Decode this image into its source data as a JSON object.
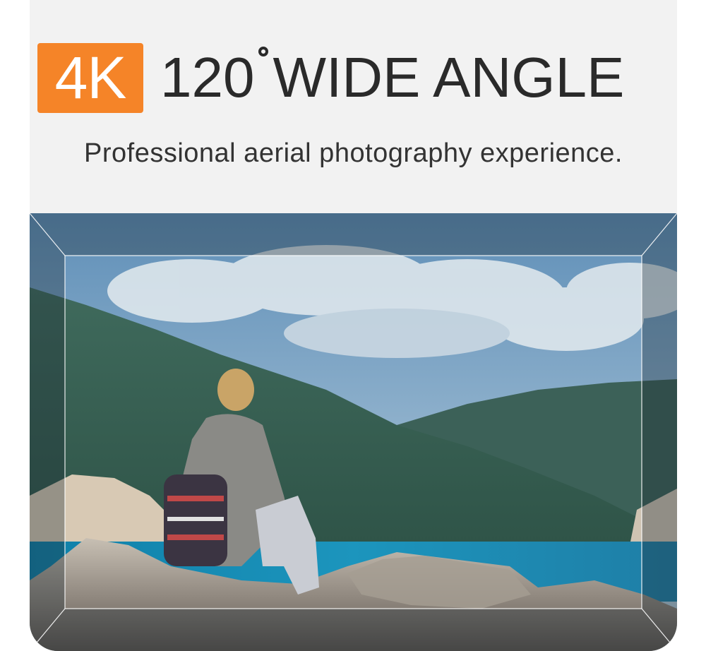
{
  "headline": {
    "badge": "4K",
    "number": "120",
    "text": "WIDE ANGLE"
  },
  "subtitle": "Professional aerial photography experience.",
  "colors": {
    "badge_orange": "#f58428",
    "background": "#f2f2f2",
    "text_dark": "#2a2a2a"
  },
  "photo": {
    "description_icon": "wide-angle-frame"
  }
}
